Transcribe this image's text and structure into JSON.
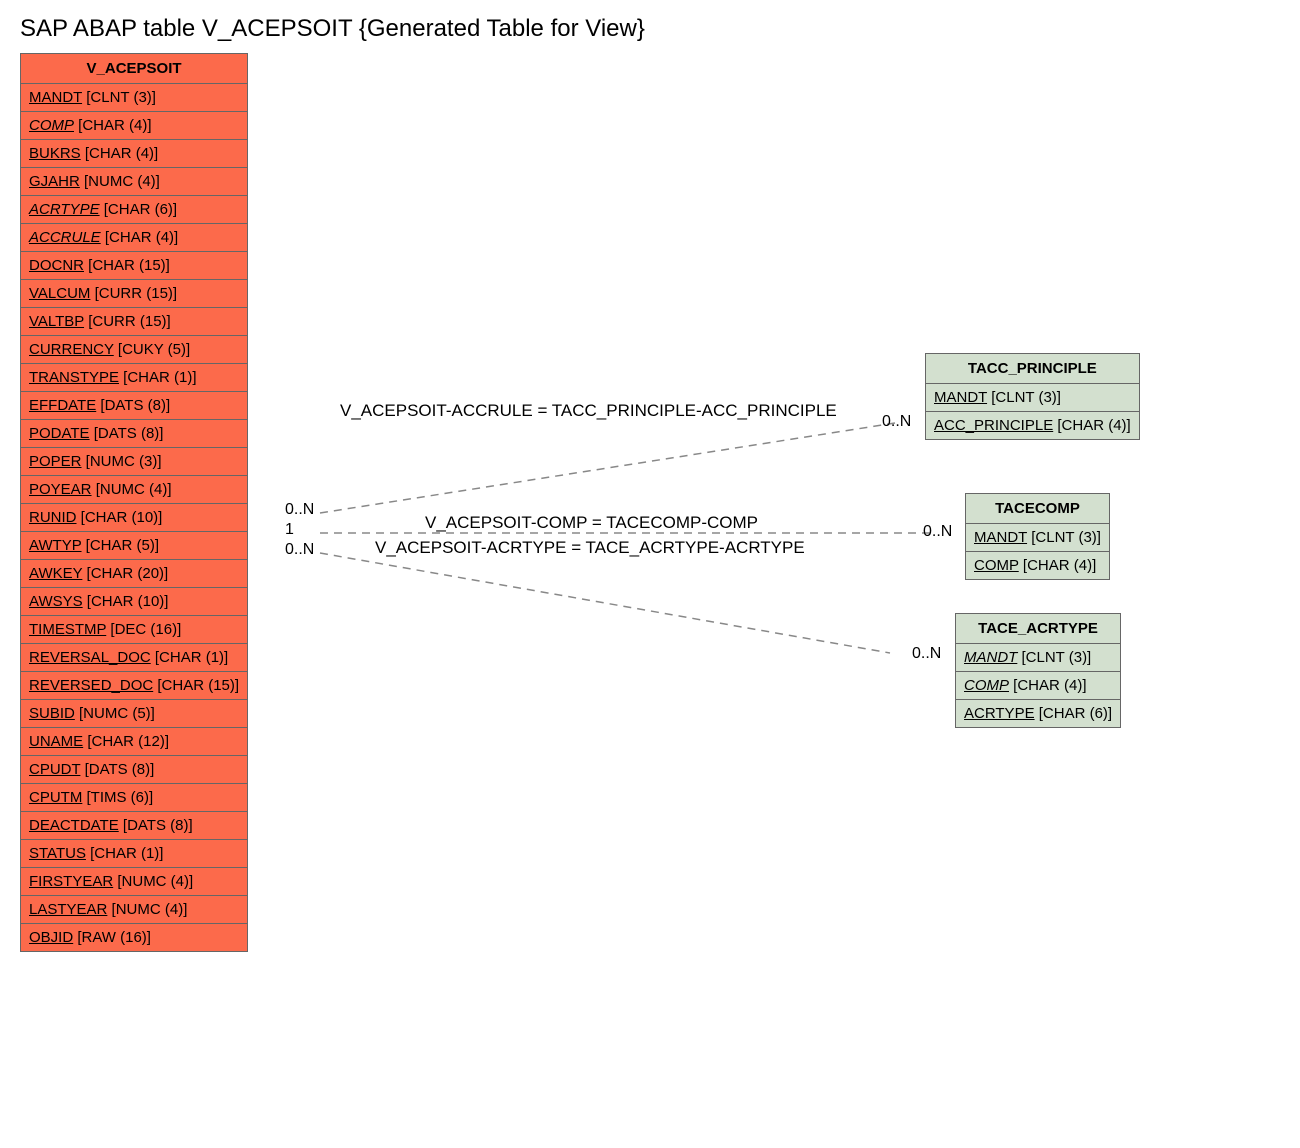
{
  "title": "SAP ABAP table V_ACEPSOIT {Generated Table for View}",
  "main": {
    "name": "V_ACEPSOIT",
    "fields": [
      {
        "name": "MANDT",
        "type": "[CLNT (3)]",
        "italic": false
      },
      {
        "name": "COMP",
        "type": "[CHAR (4)]",
        "italic": true
      },
      {
        "name": "BUKRS",
        "type": "[CHAR (4)]",
        "italic": false
      },
      {
        "name": "GJAHR",
        "type": "[NUMC (4)]",
        "italic": false
      },
      {
        "name": "ACRTYPE",
        "type": "[CHAR (6)]",
        "italic": true
      },
      {
        "name": "ACCRULE",
        "type": "[CHAR (4)]",
        "italic": true
      },
      {
        "name": "DOCNR",
        "type": "[CHAR (15)]",
        "italic": false
      },
      {
        "name": "VALCUM",
        "type": "[CURR (15)]",
        "italic": false
      },
      {
        "name": "VALTBP",
        "type": "[CURR (15)]",
        "italic": false
      },
      {
        "name": "CURRENCY",
        "type": "[CUKY (5)]",
        "italic": false
      },
      {
        "name": "TRANSTYPE",
        "type": "[CHAR (1)]",
        "italic": false
      },
      {
        "name": "EFFDATE",
        "type": "[DATS (8)]",
        "italic": false
      },
      {
        "name": "PODATE",
        "type": "[DATS (8)]",
        "italic": false
      },
      {
        "name": "POPER",
        "type": "[NUMC (3)]",
        "italic": false
      },
      {
        "name": "POYEAR",
        "type": "[NUMC (4)]",
        "italic": false
      },
      {
        "name": "RUNID",
        "type": "[CHAR (10)]",
        "italic": false
      },
      {
        "name": "AWTYP",
        "type": "[CHAR (5)]",
        "italic": false
      },
      {
        "name": "AWKEY",
        "type": "[CHAR (20)]",
        "italic": false
      },
      {
        "name": "AWSYS",
        "type": "[CHAR (10)]",
        "italic": false
      },
      {
        "name": "TIMESTMP",
        "type": "[DEC (16)]",
        "italic": false
      },
      {
        "name": "REVERSAL_DOC",
        "type": "[CHAR (1)]",
        "italic": false
      },
      {
        "name": "REVERSED_DOC",
        "type": "[CHAR (15)]",
        "italic": false
      },
      {
        "name": "SUBID",
        "type": "[NUMC (5)]",
        "italic": false
      },
      {
        "name": "UNAME",
        "type": "[CHAR (12)]",
        "italic": false
      },
      {
        "name": "CPUDT",
        "type": "[DATS (8)]",
        "italic": false
      },
      {
        "name": "CPUTM",
        "type": "[TIMS (6)]",
        "italic": false
      },
      {
        "name": "DEACTDATE",
        "type": "[DATS (8)]",
        "italic": false
      },
      {
        "name": "STATUS",
        "type": "[CHAR (1)]",
        "italic": false
      },
      {
        "name": "FIRSTYEAR",
        "type": "[NUMC (4)]",
        "italic": false
      },
      {
        "name": "LASTYEAR",
        "type": "[NUMC (4)]",
        "italic": false
      },
      {
        "name": "OBJID",
        "type": "[RAW (16)]",
        "italic": false
      }
    ]
  },
  "related": [
    {
      "id": "tacc-principle",
      "name": "TACC_PRINCIPLE",
      "fields": [
        {
          "name": "MANDT",
          "type": "[CLNT (3)]",
          "italic": false
        },
        {
          "name": "ACC_PRINCIPLE",
          "type": "[CHAR (4)]",
          "italic": false
        }
      ]
    },
    {
      "id": "tacecomp",
      "name": "TACECOMP",
      "fields": [
        {
          "name": "MANDT",
          "type": "[CLNT (3)]",
          "italic": false
        },
        {
          "name": "COMP",
          "type": "[CHAR (4)]",
          "italic": false
        }
      ]
    },
    {
      "id": "tace-acrtype",
      "name": "TACE_ACRTYPE",
      "fields": [
        {
          "name": "MANDT",
          "type": "[CLNT (3)]",
          "italic": true
        },
        {
          "name": "COMP",
          "type": "[CHAR (4)]",
          "italic": true
        },
        {
          "name": "ACRTYPE",
          "type": "[CHAR (6)]",
          "italic": false
        }
      ]
    }
  ],
  "edges": {
    "label1": "V_ACEPSOIT-ACCRULE = TACC_PRINCIPLE-ACC_PRINCIPLE",
    "label2": "V_ACEPSOIT-COMP = TACECOMP-COMP",
    "label3": "V_ACEPSOIT-ACRTYPE = TACE_ACRTYPE-ACRTYPE",
    "card_left_top": "0..N",
    "card_left_mid": "1",
    "card_left_bot": "0..N",
    "card_right_1": "0..N",
    "card_right_2": "0..N",
    "card_right_3": "0..N"
  }
}
